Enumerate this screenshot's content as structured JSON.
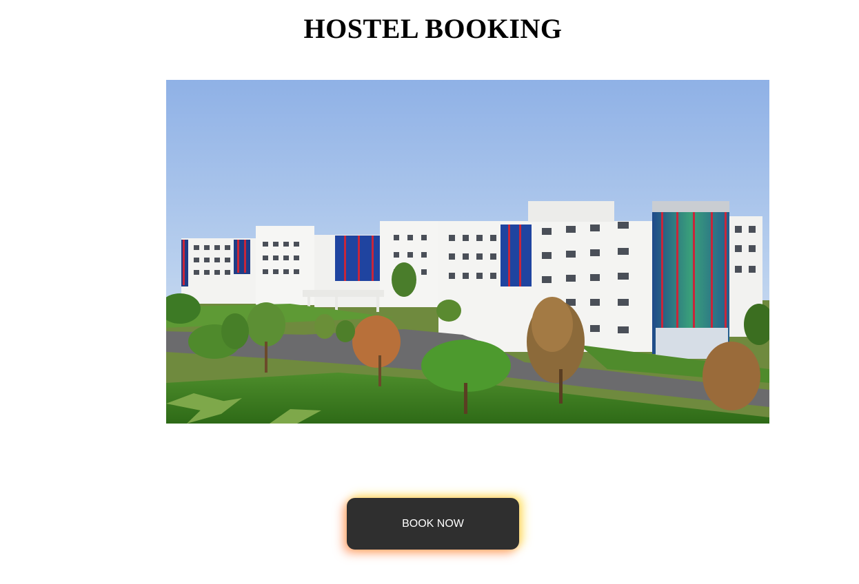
{
  "header": {
    "title": "HOSTEL BOOKING"
  },
  "hero": {
    "alt": "hostel building image"
  },
  "actions": {
    "book_label": "BOOK NOW"
  },
  "colors": {
    "button_bg": "#2f2f2f",
    "button_text": "#ffffff",
    "glow_orange": "#ff7a3c",
    "glow_yellow": "#ffe13c"
  }
}
